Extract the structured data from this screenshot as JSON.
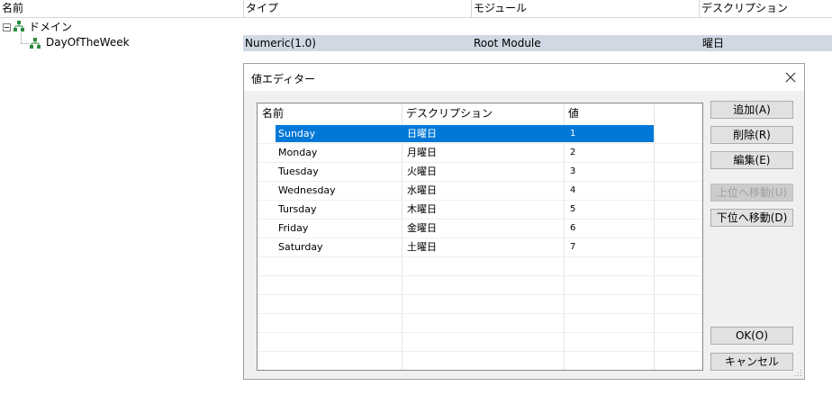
{
  "columns": [
    "名前",
    "タイプ",
    "モジュール",
    "デスクリプション"
  ],
  "tree": {
    "root_label": "ドメイン",
    "child": {
      "name": "DayOfTheWeek",
      "type": "Numeric(1.0)",
      "module": "Root Module",
      "description": "曜日"
    }
  },
  "dialog": {
    "title": "値エディター",
    "grid_headers": [
      "名前",
      "デスクリプション",
      "値"
    ],
    "rows": [
      {
        "name": "Sunday",
        "desc": "日曜日",
        "value": "1"
      },
      {
        "name": "Monday",
        "desc": "月曜日",
        "value": "2"
      },
      {
        "name": "Tuesday",
        "desc": "火曜日",
        "value": "3"
      },
      {
        "name": "Wednesday",
        "desc": "水曜日",
        "value": "4"
      },
      {
        "name": "Tursday",
        "desc": "木曜日",
        "value": "5"
      },
      {
        "name": "Friday",
        "desc": "金曜日",
        "value": "6"
      },
      {
        "name": "Saturday",
        "desc": "土曜日",
        "value": "7"
      }
    ],
    "buttons": {
      "add": "追加(A)",
      "delete": "削除(R)",
      "edit": "編集(E)",
      "move_up": "上位へ移動(U)",
      "move_down": "下位へ移動(D)",
      "ok": "OK(O)",
      "cancel": "キャンセル"
    }
  },
  "colors": {
    "selection": "#0078d7",
    "row_highlight": "#cfd8e3"
  }
}
